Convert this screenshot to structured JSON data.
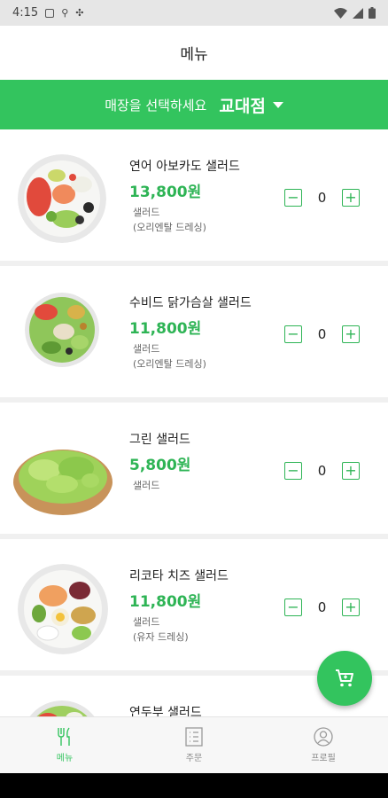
{
  "status": {
    "time": "4:15"
  },
  "header": {
    "title": "메뉴"
  },
  "store": {
    "prompt": "매장을 선택하세요",
    "selected": "교대점"
  },
  "items": [
    {
      "name": "연어 아보카도 샐러드",
      "price": "13,800원",
      "category": "샐러드",
      "dressing": "(오리엔탈 드레싱)",
      "qty": "0"
    },
    {
      "name": "수비드 닭가슴살 샐러드",
      "price": "11,800원",
      "category": "샐러드",
      "dressing": "(오리엔탈 드레싱)",
      "qty": "0"
    },
    {
      "name": "그린 샐러드",
      "price": "5,800원",
      "category": "샐러드",
      "qty": "0"
    },
    {
      "name": "리코타 치즈 샐러드",
      "price": "11,800원",
      "category": "샐러드",
      "dressing": "(유자 드레싱)",
      "qty": "0"
    },
    {
      "name": "연두부 샐러드"
    }
  ],
  "nav": {
    "menu": "메뉴",
    "order": "주문",
    "profile": "프로필"
  },
  "colors": {
    "accent": "#33c45e",
    "price": "#2eb455"
  },
  "icons": [
    "fork-knife-icon",
    "list-icon",
    "person-icon",
    "cart-icon",
    "minus-icon",
    "plus-icon"
  ]
}
